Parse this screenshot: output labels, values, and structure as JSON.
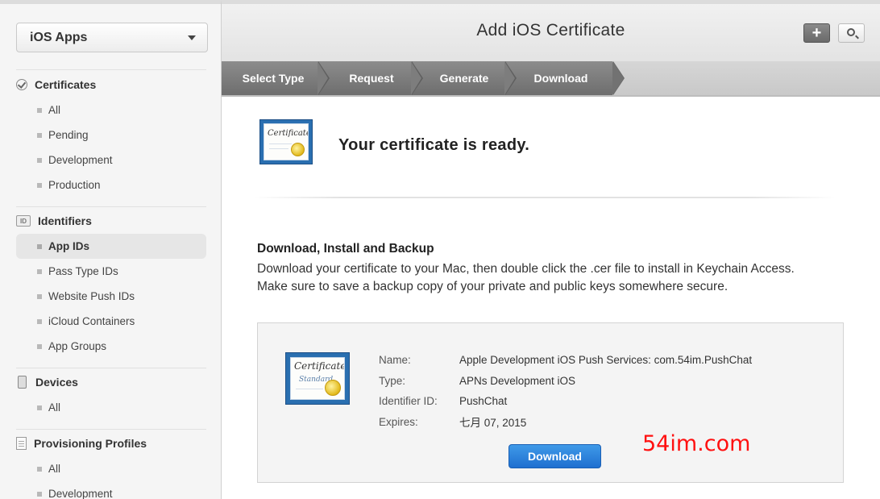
{
  "sidebar": {
    "platform": "iOS Apps",
    "sections": {
      "certificates": {
        "title": "Certificates",
        "items": [
          "All",
          "Pending",
          "Development",
          "Production"
        ]
      },
      "identifiers": {
        "title": "Identifiers",
        "icon_text": "ID",
        "items": [
          "App IDs",
          "Pass Type IDs",
          "Website Push IDs",
          "iCloud Containers",
          "App Groups"
        ],
        "active": "App IDs"
      },
      "devices": {
        "title": "Devices",
        "items": [
          "All"
        ]
      },
      "profiles": {
        "title": "Provisioning Profiles",
        "items": [
          "All",
          "Development"
        ]
      }
    }
  },
  "header": {
    "title": "Add iOS Certificate",
    "add_label": "+",
    "icons": {
      "add": "plus-icon",
      "search": "search-icon"
    }
  },
  "steps": {
    "items": [
      "Select Type",
      "Request",
      "Generate",
      "Download"
    ],
    "current": "Download"
  },
  "main": {
    "ready_text": "Your certificate is ready.",
    "cert_icon_text": "Certificate",
    "cert_icon_subtext": "Standard",
    "download_title": "Download, Install and Backup",
    "download_text": "Download your certificate to your Mac, then double click the .cer file to install in Keychain Access. Make sure to save a backup copy of your private and public keys somewhere secure.",
    "details": {
      "name_label": "Name:",
      "name_value": "Apple Development iOS Push Services: com.54im.PushChat",
      "type_label": "Type:",
      "type_value": "APNs Development iOS",
      "identifier_label": "Identifier ID:",
      "identifier_value": "PushChat",
      "expires_label": "Expires:",
      "expires_value": "七月 07, 2015"
    },
    "download_button": "Download"
  },
  "watermark": "54im.com",
  "colors": {
    "download_button": "#2a7fdc",
    "step_bar_active": "#7d7d7d",
    "certificate_frame": "#2a6fb0",
    "watermark": "#ff1010"
  }
}
